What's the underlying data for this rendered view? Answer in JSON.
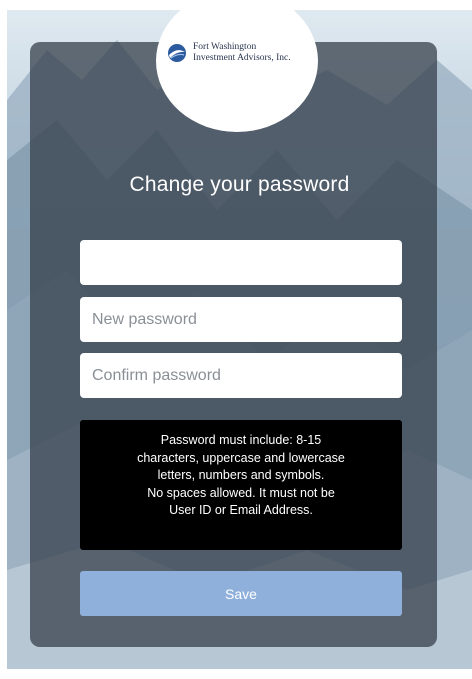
{
  "logo": {
    "line1": "Fort Washington",
    "line2": "Investment Advisors, Inc."
  },
  "form": {
    "title": "Change your password",
    "current_password": {
      "value": "",
      "placeholder": ""
    },
    "new_password": {
      "value": "",
      "placeholder": "New password"
    },
    "confirm_password": {
      "value": "",
      "placeholder": "Confirm password"
    },
    "rules": {
      "line1": "Password must include: 8-15",
      "line2": "characters, uppercase and lowercase",
      "line3": "letters, numbers and symbols.",
      "line4": "No spaces allowed. It must not be",
      "line5": "User ID or Email Address."
    },
    "save_label": "Save"
  },
  "colors": {
    "card_overlay": "#343e4a",
    "save_button": "#8fb0db",
    "rules_box": "#000000"
  },
  "icons": {
    "logo_mark": "globe-swoosh-icon"
  }
}
